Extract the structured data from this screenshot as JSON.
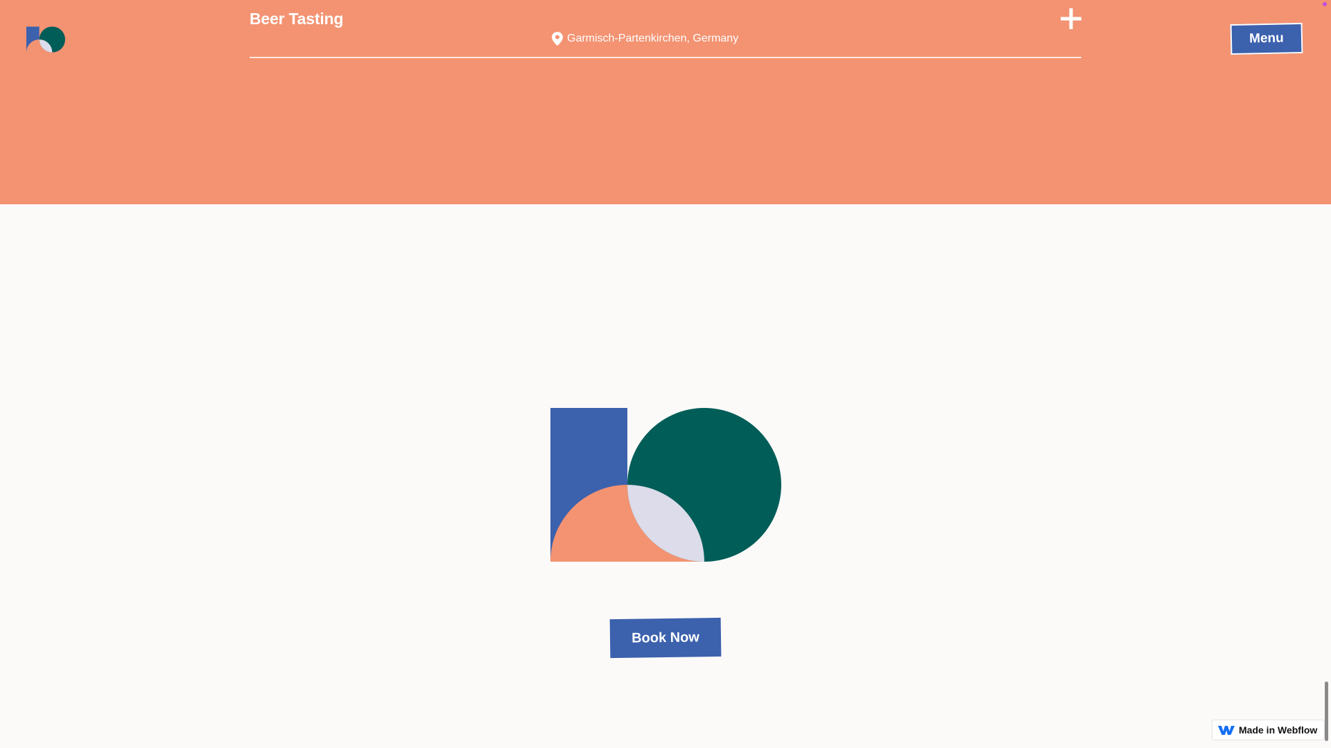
{
  "header": {
    "title": "Beer Tasting",
    "location": "Garmisch-Partenkirchen, Germany",
    "menu_label": "Menu"
  },
  "main": {
    "cta_label": "Book Now"
  },
  "badge": {
    "label": "Made in Webflow"
  },
  "icons": {
    "logo": "brand-logo-icon",
    "location": "map-pin-icon",
    "add": "plus-icon",
    "webflow": "webflow-logo-icon"
  },
  "colors": {
    "hero_background": "#f39372",
    "page_background": "#fcfaf9",
    "brand_blue": "#3c61ad",
    "brand_green": "#005d58",
    "brand_peach": "#f39372",
    "brand_lavender": "#dcdcea"
  }
}
